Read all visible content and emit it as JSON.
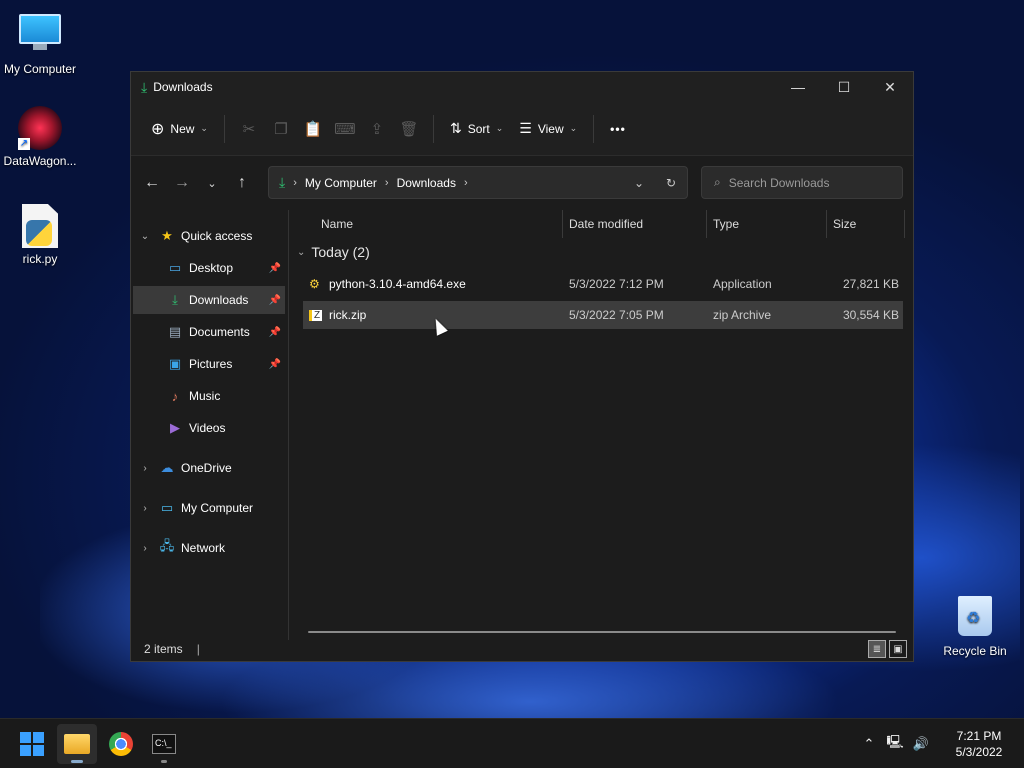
{
  "desktop": {
    "icons": [
      {
        "label": "My Computer"
      },
      {
        "label": "DataWagon..."
      },
      {
        "label": "rick.py"
      },
      {
        "label": "Recycle Bin"
      }
    ]
  },
  "window": {
    "title": "Downloads",
    "controls": {
      "minimize": "—",
      "maximize": "☐",
      "close": "✕"
    }
  },
  "toolbar": {
    "new_label": "New",
    "sort_label": "Sort",
    "view_label": "View",
    "more_label": "•••"
  },
  "address": {
    "crumbs": [
      "My Computer",
      "Downloads"
    ]
  },
  "search": {
    "placeholder": "Search Downloads"
  },
  "navpane": {
    "quick_access": "Quick access",
    "items": [
      {
        "label": "Desktop",
        "icon": "desktop-icon"
      },
      {
        "label": "Downloads",
        "icon": "downloads-icon"
      },
      {
        "label": "Documents",
        "icon": "documents-icon"
      },
      {
        "label": "Pictures",
        "icon": "pictures-icon"
      },
      {
        "label": "Music",
        "icon": "music-icon"
      },
      {
        "label": "Videos",
        "icon": "videos-icon"
      }
    ],
    "roots": [
      {
        "label": "OneDrive"
      },
      {
        "label": "My Computer"
      },
      {
        "label": "Network"
      }
    ]
  },
  "files": {
    "columns": [
      "Name",
      "Date modified",
      "Type",
      "Size"
    ],
    "group": "Today (2)",
    "rows": [
      {
        "name": "python-3.10.4-amd64.exe",
        "date": "5/3/2022 7:12 PM",
        "type": "Application",
        "size": "27,821 KB"
      },
      {
        "name": "rick.zip",
        "date": "5/3/2022 7:05 PM",
        "type": "zip Archive",
        "size": "30,554 KB"
      }
    ]
  },
  "status": {
    "count": "2 items"
  },
  "taskbar": {
    "time": "7:21 PM",
    "date": "5/3/2022"
  },
  "colors": {
    "accent": "#2fbf71",
    "selection": "#3d3d3d",
    "window_bg": "#1c1c1c"
  }
}
